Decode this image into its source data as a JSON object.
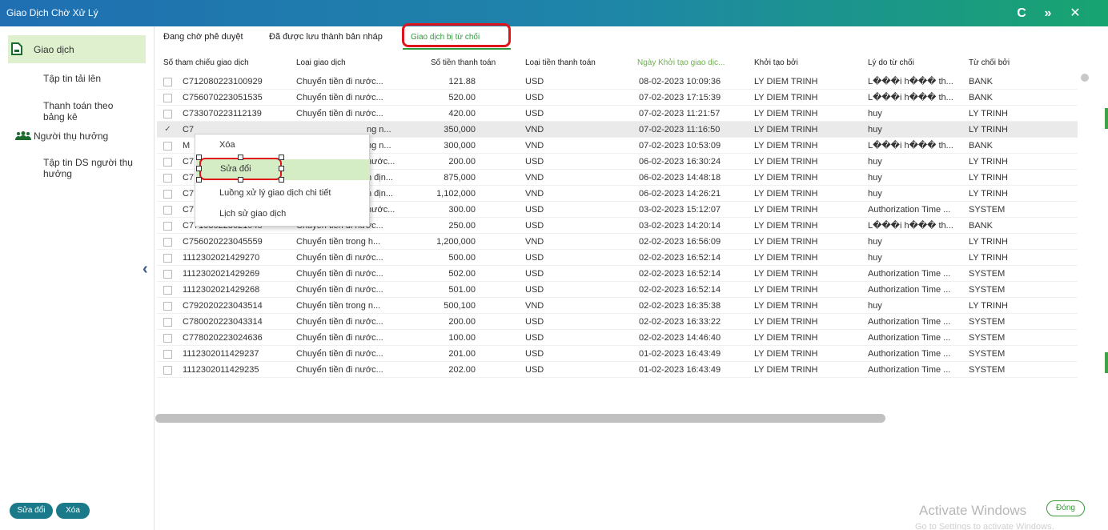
{
  "window": {
    "title": "Giao Dịch Chờ Xử Lý",
    "refresh_icon": "C",
    "expand_icon": "»",
    "close_icon": "✕"
  },
  "sidebar": {
    "items": [
      {
        "label": "Giao dịch",
        "icon": "document-icon"
      },
      {
        "label": "Tập tin tải lên"
      },
      {
        "label": "Thanh toán theo bảng kê"
      },
      {
        "label": "Người thụ hưởng",
        "icon": "users-icon"
      },
      {
        "label": "Tập tin DS người thụ hưởng"
      }
    ]
  },
  "tabs": [
    {
      "label": "Đang chờ phê duyệt"
    },
    {
      "label": "Đã được lưu thành bản nháp"
    },
    {
      "label": "Giao dịch bị từ chối",
      "active": true
    }
  ],
  "columns": [
    "Số tham chiếu giao dịch",
    "Loại giao dịch",
    "Số tiền thanh toán",
    "Loại tiền thanh toán",
    "Ngày Khởi tạo giao dịc...",
    "Khởi tạo bởi",
    "Lý do từ chối",
    "Từ chối bởi"
  ],
  "rows": [
    {
      "ref": "C712080223100929",
      "type": "Chuyển tiền đi nước...",
      "amount": "121.88",
      "currency": "USD",
      "date": "08-02-2023 10:09:36",
      "by": "LY DIEM TRINH",
      "reason": "L���i h��� th...",
      "rejected_by": "BANK",
      "checked": false
    },
    {
      "ref": "C756070223051535",
      "type": "Chuyển tiền đi nước...",
      "amount": "520.00",
      "currency": "USD",
      "date": "07-02-2023 17:15:39",
      "by": "LY DIEM TRINH",
      "reason": "L���i h��� th...",
      "rejected_by": "BANK",
      "checked": false
    },
    {
      "ref": "C733070223112139",
      "type": "Chuyển tiền đi nước...",
      "amount": "420.00",
      "currency": "USD",
      "date": "07-02-2023 11:21:57",
      "by": "LY DIEM TRINH",
      "reason": "huy",
      "rejected_by": "LY TRINH",
      "checked": false
    },
    {
      "ref": "C7",
      "type": "",
      "type_tail": "ng n...",
      "amount": "350,000",
      "currency": "VND",
      "date": "07-02-2023 11:16:50",
      "by": "LY DIEM TRINH",
      "reason": "huy",
      "rejected_by": "LY TRINH",
      "checked": true,
      "selected": true
    },
    {
      "ref": "M",
      "type": "",
      "type_tail": "ng n...",
      "amount": "300,000",
      "currency": "VND",
      "date": "07-02-2023 10:53:09",
      "by": "LY DIEM TRINH",
      "reason": "L���i h��� th...",
      "rejected_by": "BANK",
      "checked": false
    },
    {
      "ref": "C7",
      "type": "",
      "type_tail": "nước...",
      "amount": "200.00",
      "currency": "USD",
      "date": "06-02-2023 16:30:24",
      "by": "LY DIEM TRINH",
      "reason": "huy",
      "rejected_by": "LY TRINH",
      "checked": false
    },
    {
      "ref": "C7",
      "type": "",
      "type_tail": "n địn...",
      "amount": "875,000",
      "currency": "VND",
      "date": "06-02-2023 14:48:18",
      "by": "LY DIEM TRINH",
      "reason": "huy",
      "rejected_by": "LY TRINH",
      "checked": false
    },
    {
      "ref": "C7",
      "type": "",
      "type_tail": "n địn...",
      "amount": "1,102,000",
      "currency": "VND",
      "date": "06-02-2023 14:26:21",
      "by": "LY DIEM TRINH",
      "reason": "huy",
      "rejected_by": "LY TRINH",
      "checked": false
    },
    {
      "ref": "C7",
      "type": "",
      "type_tail": "nước...",
      "amount": "300.00",
      "currency": "USD",
      "date": "03-02-2023 15:12:07",
      "by": "LY DIEM TRINH",
      "reason": "Authorization Time ...",
      "rejected_by": "SYSTEM",
      "checked": false
    },
    {
      "ref": "C771030223021945",
      "type": "Chuyển tiền đi nước...",
      "amount": "250.00",
      "currency": "USD",
      "date": "03-02-2023 14:20:14",
      "by": "LY DIEM TRINH",
      "reason": "L���i h��� th...",
      "rejected_by": "BANK",
      "checked": false
    },
    {
      "ref": "C756020223045559",
      "type": "Chuyển tiền trong h...",
      "amount": "1,200,000",
      "currency": "VND",
      "date": "02-02-2023 16:56:09",
      "by": "LY DIEM TRINH",
      "reason": "huy",
      "rejected_by": "LY TRINH",
      "checked": false
    },
    {
      "ref": "1112302021429270",
      "type": "Chuyển tiền đi nước...",
      "amount": "500.00",
      "currency": "USD",
      "date": "02-02-2023 16:52:14",
      "by": "LY DIEM TRINH",
      "reason": "huy",
      "rejected_by": "LY TRINH",
      "checked": false
    },
    {
      "ref": "1112302021429269",
      "type": "Chuyển tiền đi nước...",
      "amount": "502.00",
      "currency": "USD",
      "date": "02-02-2023 16:52:14",
      "by": "LY DIEM TRINH",
      "reason": "Authorization Time ...",
      "rejected_by": "SYSTEM",
      "checked": false
    },
    {
      "ref": "1112302021429268",
      "type": "Chuyển tiền đi nước...",
      "amount": "501.00",
      "currency": "USD",
      "date": "02-02-2023 16:52:14",
      "by": "LY DIEM TRINH",
      "reason": "Authorization Time ...",
      "rejected_by": "SYSTEM",
      "checked": false
    },
    {
      "ref": "C792020223043514",
      "type": "Chuyển tiền trong n...",
      "amount": "500,100",
      "currency": "VND",
      "date": "02-02-2023 16:35:38",
      "by": "LY DIEM TRINH",
      "reason": "huy",
      "rejected_by": "LY TRINH",
      "checked": false
    },
    {
      "ref": "C780020223043314",
      "type": "Chuyển tiền đi nước...",
      "amount": "200.00",
      "currency": "USD",
      "date": "02-02-2023 16:33:22",
      "by": "LY DIEM TRINH",
      "reason": "Authorization Time ...",
      "rejected_by": "SYSTEM",
      "checked": false
    },
    {
      "ref": "C778020223024636",
      "type": "Chuyển tiền đi nước...",
      "amount": "100.00",
      "currency": "USD",
      "date": "02-02-2023 14:46:40",
      "by": "LY DIEM TRINH",
      "reason": "Authorization Time ...",
      "rejected_by": "SYSTEM",
      "checked": false
    },
    {
      "ref": "1112302011429237",
      "type": "Chuyển tiền đi nước...",
      "amount": "201.00",
      "currency": "USD",
      "date": "01-02-2023 16:43:49",
      "by": "LY DIEM TRINH",
      "reason": "Authorization Time ...",
      "rejected_by": "SYSTEM",
      "checked": false
    },
    {
      "ref": "1112302011429235",
      "type": "Chuyển tiền đi nước...",
      "amount": "202.00",
      "currency": "USD",
      "date": "01-02-2023 16:43:49",
      "by": "LY DIEM TRINH",
      "reason": "Authorization Time ...",
      "rejected_by": "SYSTEM",
      "checked": false
    }
  ],
  "context_menu": {
    "items": [
      "Xóa",
      "Sửa đổi",
      "Luồng xử lý giao dịch chi tiết",
      "Lịch sử giao dịch"
    ],
    "highlighted": 1
  },
  "footer": {
    "edit_button": "Sửa đổi",
    "delete_button": "Xóa",
    "close_button": "Đóng",
    "watermark_title": "Activate Windows",
    "watermark_sub": "Go to Settings to activate Windows."
  },
  "colors": {
    "accent_green": "#2e9a3b",
    "title_start": "#1f6fb2",
    "title_end": "#18a470",
    "highlight_red": "#e0141b"
  }
}
